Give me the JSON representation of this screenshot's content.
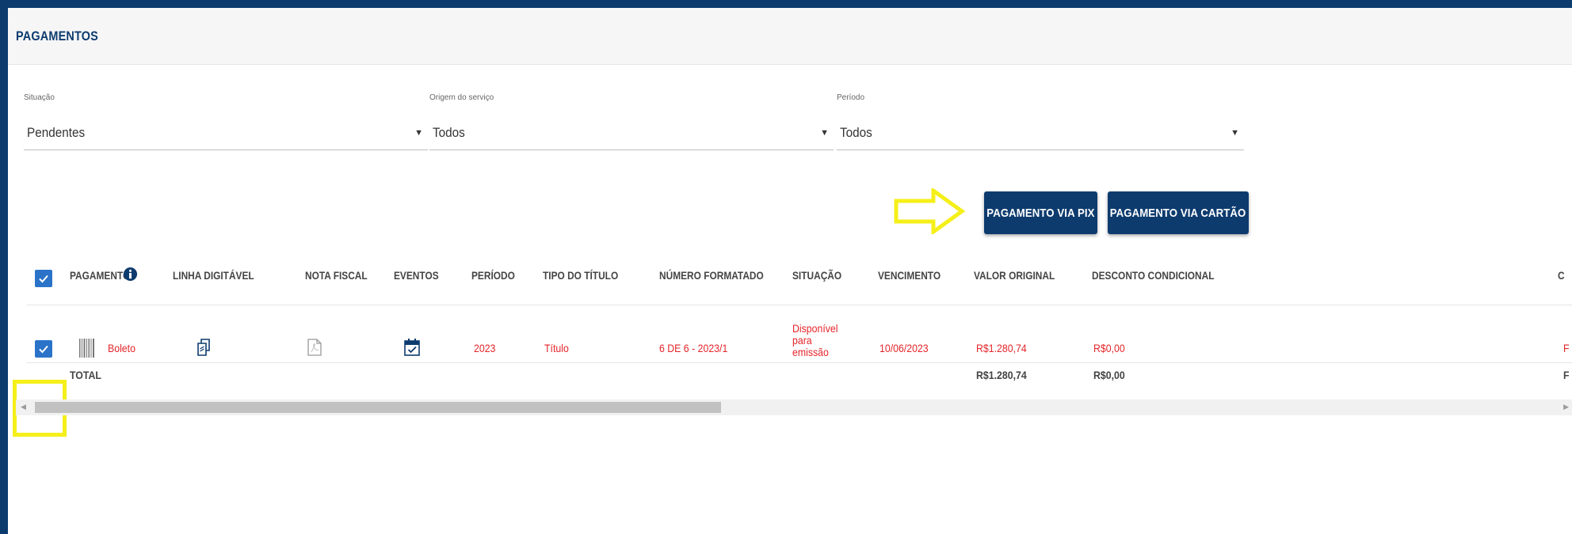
{
  "page": {
    "title": "PAGAMENTOS"
  },
  "filters": {
    "situacao": {
      "label": "Situação",
      "value": "Pendentes"
    },
    "origem": {
      "label": "Origem do serviço",
      "value": "Todos"
    },
    "periodo": {
      "label": "Período",
      "value": "Todos"
    }
  },
  "actions": {
    "pix_label": "PAGAMENTO VIA PIX",
    "cartao_label": "PAGAMENTO VIA CARTÃO"
  },
  "table": {
    "columns": [
      "PAGAMENTO",
      "LINHA DIGITÁVEL",
      "NOTA FISCAL",
      "EVENTOS",
      "PERÍODO",
      "TIPO DO TÍTULO",
      "NÚMERO FORMATADO",
      "SITUAÇÃO",
      "VENCIMENTO",
      "VALOR ORIGINAL",
      "DESCONTO CONDICIONAL",
      "C"
    ],
    "rows": [
      {
        "checked": true,
        "pagamento": "Boleto",
        "periodo": "2023",
        "tipo": "Título",
        "numero": "6 DE 6 - 2023/1",
        "situacao": "Disponível para emissão",
        "vencimento": "10/06/2023",
        "valor_original": "R$1.280,74",
        "desconto": "R$0,00",
        "extra": "F"
      }
    ],
    "total": {
      "label": "TOTAL",
      "valor_original": "R$1.280,74",
      "desconto": "R$0,00",
      "extra": "F"
    }
  },
  "colors": {
    "brand": "#0d3b6e",
    "accent_red": "#e5252a",
    "checkbox": "#2a73c9",
    "highlight": "#f5ef1a"
  },
  "icons": [
    "info-icon",
    "barcode-icon",
    "copy-icon",
    "pdf-file-icon",
    "calendar-check-icon",
    "dropdown-arrow-icon",
    "check-icon",
    "scroll-left-icon",
    "scroll-right-icon"
  ]
}
